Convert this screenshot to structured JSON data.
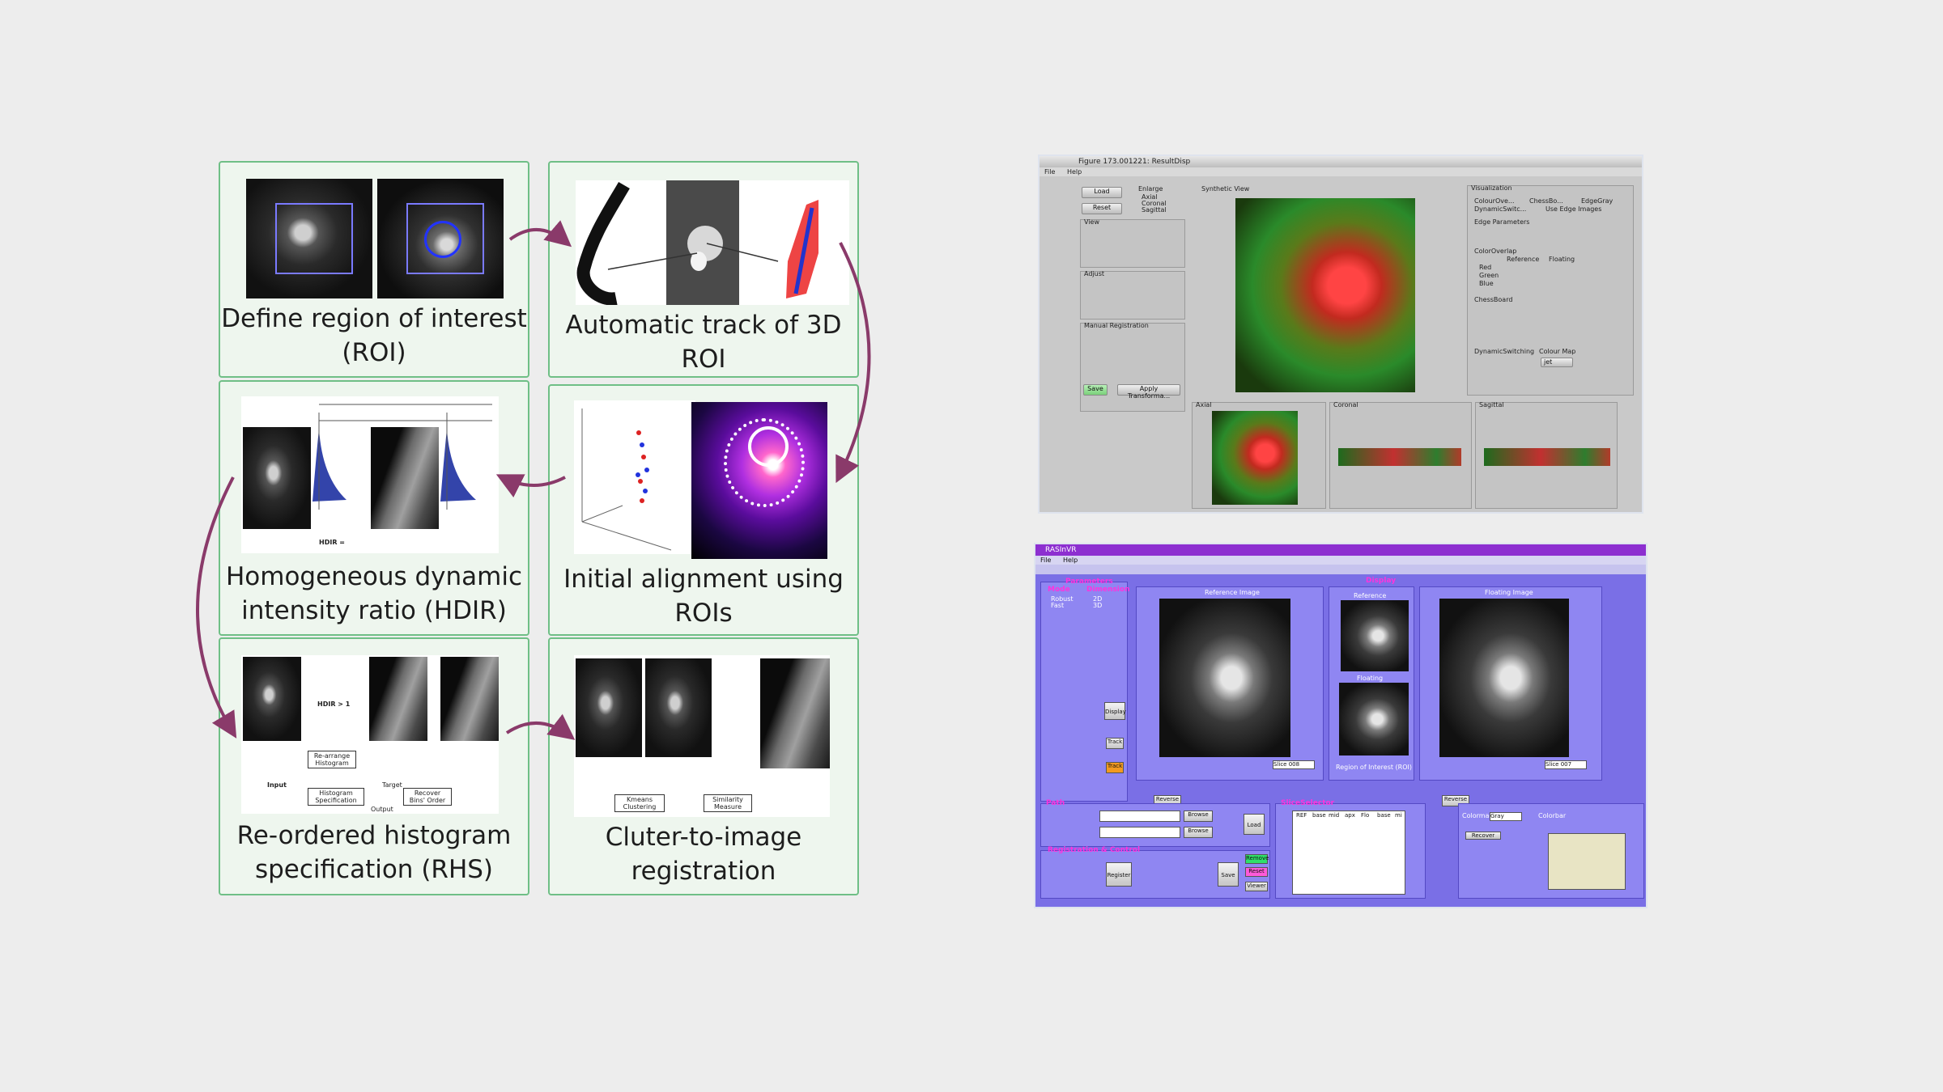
{
  "steps": [
    {
      "caption": "Define region of interest\n(ROI)"
    },
    {
      "caption": "Automatic track of 3D\nROI"
    },
    {
      "caption": "Homogeneous dynamic\nintensity ratio (HDIR)"
    },
    {
      "caption": "Initial alignment using\nROIs"
    },
    {
      "caption": "Re-ordered histogram\nspecification (RHS)"
    },
    {
      "caption": "Cluter-to-image\nregistration"
    }
  ],
  "figure_labels": {
    "hdir": "HDIR > 1",
    "rearrange": "Re-arrange Histogram",
    "histspec": "Histogram Specification",
    "recover": "Recover Bins' Order",
    "input": "Input",
    "target": "Target",
    "output": "Output",
    "kmeans": "Kmeans Clustering",
    "similarity": "Similarity Measure",
    "hdir_formula": "HDIR ="
  },
  "screenshot1": {
    "title": "Figure 173.001221: ResultDisp",
    "menu": [
      "File",
      "Help"
    ],
    "buttons": [
      "Load",
      "Reset",
      "Save",
      "Apply Transforma..."
    ],
    "sections": [
      "Enlarge",
      "View",
      "Adjust",
      "Manual Registration",
      "Synthetic View",
      "Visualization",
      "Edge Parameters",
      "ColorOverlap",
      "ChessBoard",
      "DynamicSwitching",
      "Colour Map"
    ],
    "enlarge_options": [
      "Axial",
      "Coronal",
      "Sagittal"
    ],
    "display_options": [
      "ColourOve...",
      "ChessBo...",
      "EdgeGray",
      "DynamicSwitc...",
      "Use Edge Images"
    ],
    "overlap_headers": [
      "Reference",
      "Floating"
    ],
    "overlap_rows": [
      "Red",
      "Green",
      "Blue"
    ],
    "colour_map_value": "jet",
    "view_labels": [
      "Axial",
      "Coronal",
      "Sagittal"
    ]
  },
  "screenshot2": {
    "title": "RASInVR",
    "menu": [
      "File",
      "Help"
    ],
    "headers": [
      "Parameters",
      "Display",
      "Path",
      "SliceSelector",
      "Registration & Control"
    ],
    "mode_label": "Mode",
    "dimension_label": "Dimension",
    "mode_options": [
      "Robust",
      "Fast"
    ],
    "dimension_options": [
      "2D",
      "3D"
    ],
    "view_titles": [
      "Reference Image",
      "Reference",
      "Floating",
      "Floating Image"
    ],
    "roi_label": "Region of Interest (ROI)",
    "buttons": [
      "Reverse",
      "Reverse",
      "Browse",
      "Browse",
      "Load",
      "Register",
      "Save",
      "Recover",
      "Display",
      "Track",
      "Track",
      "Remove",
      "Reset",
      "Viewer"
    ],
    "slice_left": "Slice 008",
    "slice_right": "Slice 007",
    "colormap_label": "Colormap",
    "colormap_value": "Gray",
    "colorbar_label": "Colorbar",
    "slice_headers": [
      "REF",
      "base",
      "mid",
      "apx",
      "Flo",
      "base",
      "mi"
    ]
  }
}
